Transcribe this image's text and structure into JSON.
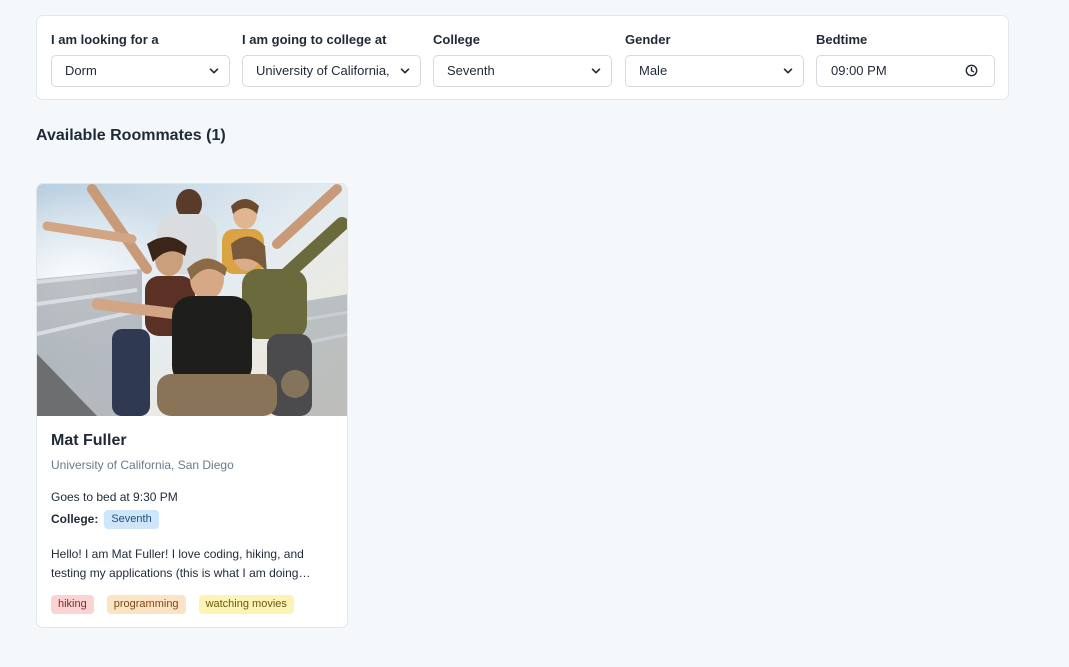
{
  "filters": {
    "looking_for": {
      "label": "I am looking for a",
      "value": "Dorm"
    },
    "college_at": {
      "label": "I am going to college at",
      "value": "University of California, San Diego"
    },
    "college": {
      "label": "College",
      "value": "Seventh"
    },
    "gender": {
      "label": "Gender",
      "value": "Male"
    },
    "bedtime": {
      "label": "Bedtime",
      "value": "09:00 PM"
    }
  },
  "results": {
    "title": "Available Roommates (1)"
  },
  "roommates": [
    {
      "name": "Mat Fuller",
      "school": "University of California, San Diego",
      "bedtime": "Goes to bed at 9:30 PM",
      "college_label": "College:",
      "college": "Seventh",
      "bio": "Hello! I am Mat Fuller! I love coding, hiking, and testing my applications (this is what I am doing…",
      "tags": [
        "hiking",
        "programming",
        "watching movies"
      ]
    }
  ],
  "icons": {
    "select": "chevron-down-icon",
    "time": "clock-icon"
  }
}
